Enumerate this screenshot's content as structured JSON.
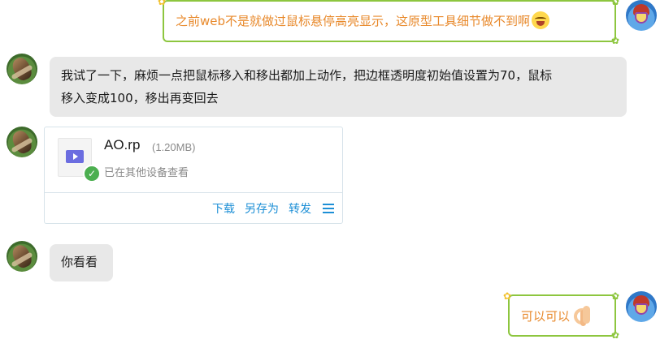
{
  "messages": [
    {
      "sender": "self",
      "text": "之前web不是就做过鼠标悬停高亮显示，这原型工具细节做不到啊",
      "emoji": "crying-laughing-face"
    },
    {
      "sender": "other",
      "text_line1": "我试了一下，麻烦一点把鼠标移入和移出都加上动作，把边框透明度初始值设置为70，鼠标",
      "text_line2": "移入变成100，移出再变回去"
    },
    {
      "sender": "other",
      "type": "file",
      "file": {
        "name": "AO.rp",
        "size": "(1.20MB)",
        "status": "已在其他设备查看",
        "actions": {
          "download": "下载",
          "save_as": "另存为",
          "forward": "转发"
        }
      }
    },
    {
      "sender": "other",
      "text": "你看看"
    },
    {
      "sender": "self",
      "text": "可以可以",
      "emoji": "ok-hand"
    }
  ],
  "colors": {
    "self_text": "#e8892b",
    "self_border": "#8dc63f",
    "other_bubble_bg": "#e8e8e8",
    "link_blue": "#1d8fd6"
  }
}
